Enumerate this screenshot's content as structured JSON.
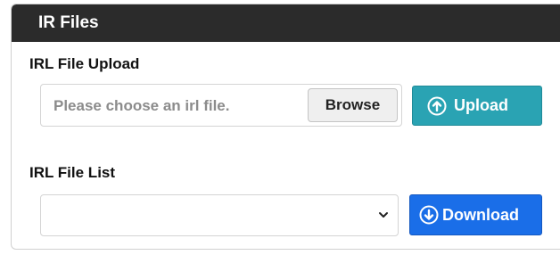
{
  "panel": {
    "title": "IR Files"
  },
  "upload_section": {
    "label": "IRL File Upload",
    "file_placeholder": "Please choose an irl file.",
    "browse_label": "Browse",
    "upload_label": "Upload",
    "upload_icon": "arrow-up-circle-icon"
  },
  "list_section": {
    "label": "IRL File List",
    "selected_value": "",
    "download_label": "Download",
    "download_icon": "arrow-down-circle-icon"
  },
  "colors": {
    "header_bg": "#2b2b2b",
    "upload_button": "#2aa3b3",
    "download_button": "#1a6ee8"
  }
}
